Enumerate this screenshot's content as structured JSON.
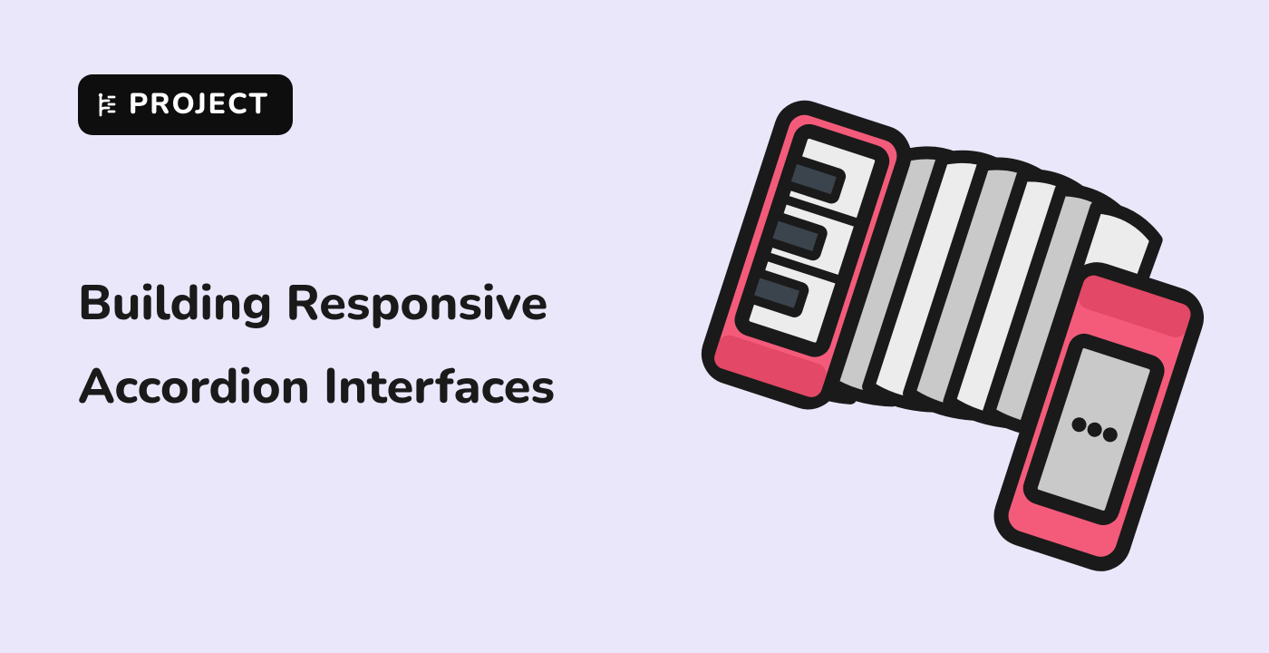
{
  "badge": {
    "label": "PROJECT",
    "icon_name": "project-icon"
  },
  "title": "Building Responsive Accordion Interfaces",
  "illustration": {
    "name": "accordion-icon",
    "colors": {
      "outline": "#1A1A1A",
      "body": "#F45B7A",
      "body_dark": "#E34866",
      "bellows_light": "#ECECEC",
      "bellows_dark": "#C9C9C9",
      "key_dark": "#3B444D"
    }
  },
  "colors": {
    "background": "#EBE7FB",
    "badge_bg": "#0E0E0E",
    "badge_text": "#FFFFFF",
    "title_text": "#1A1A1A"
  }
}
